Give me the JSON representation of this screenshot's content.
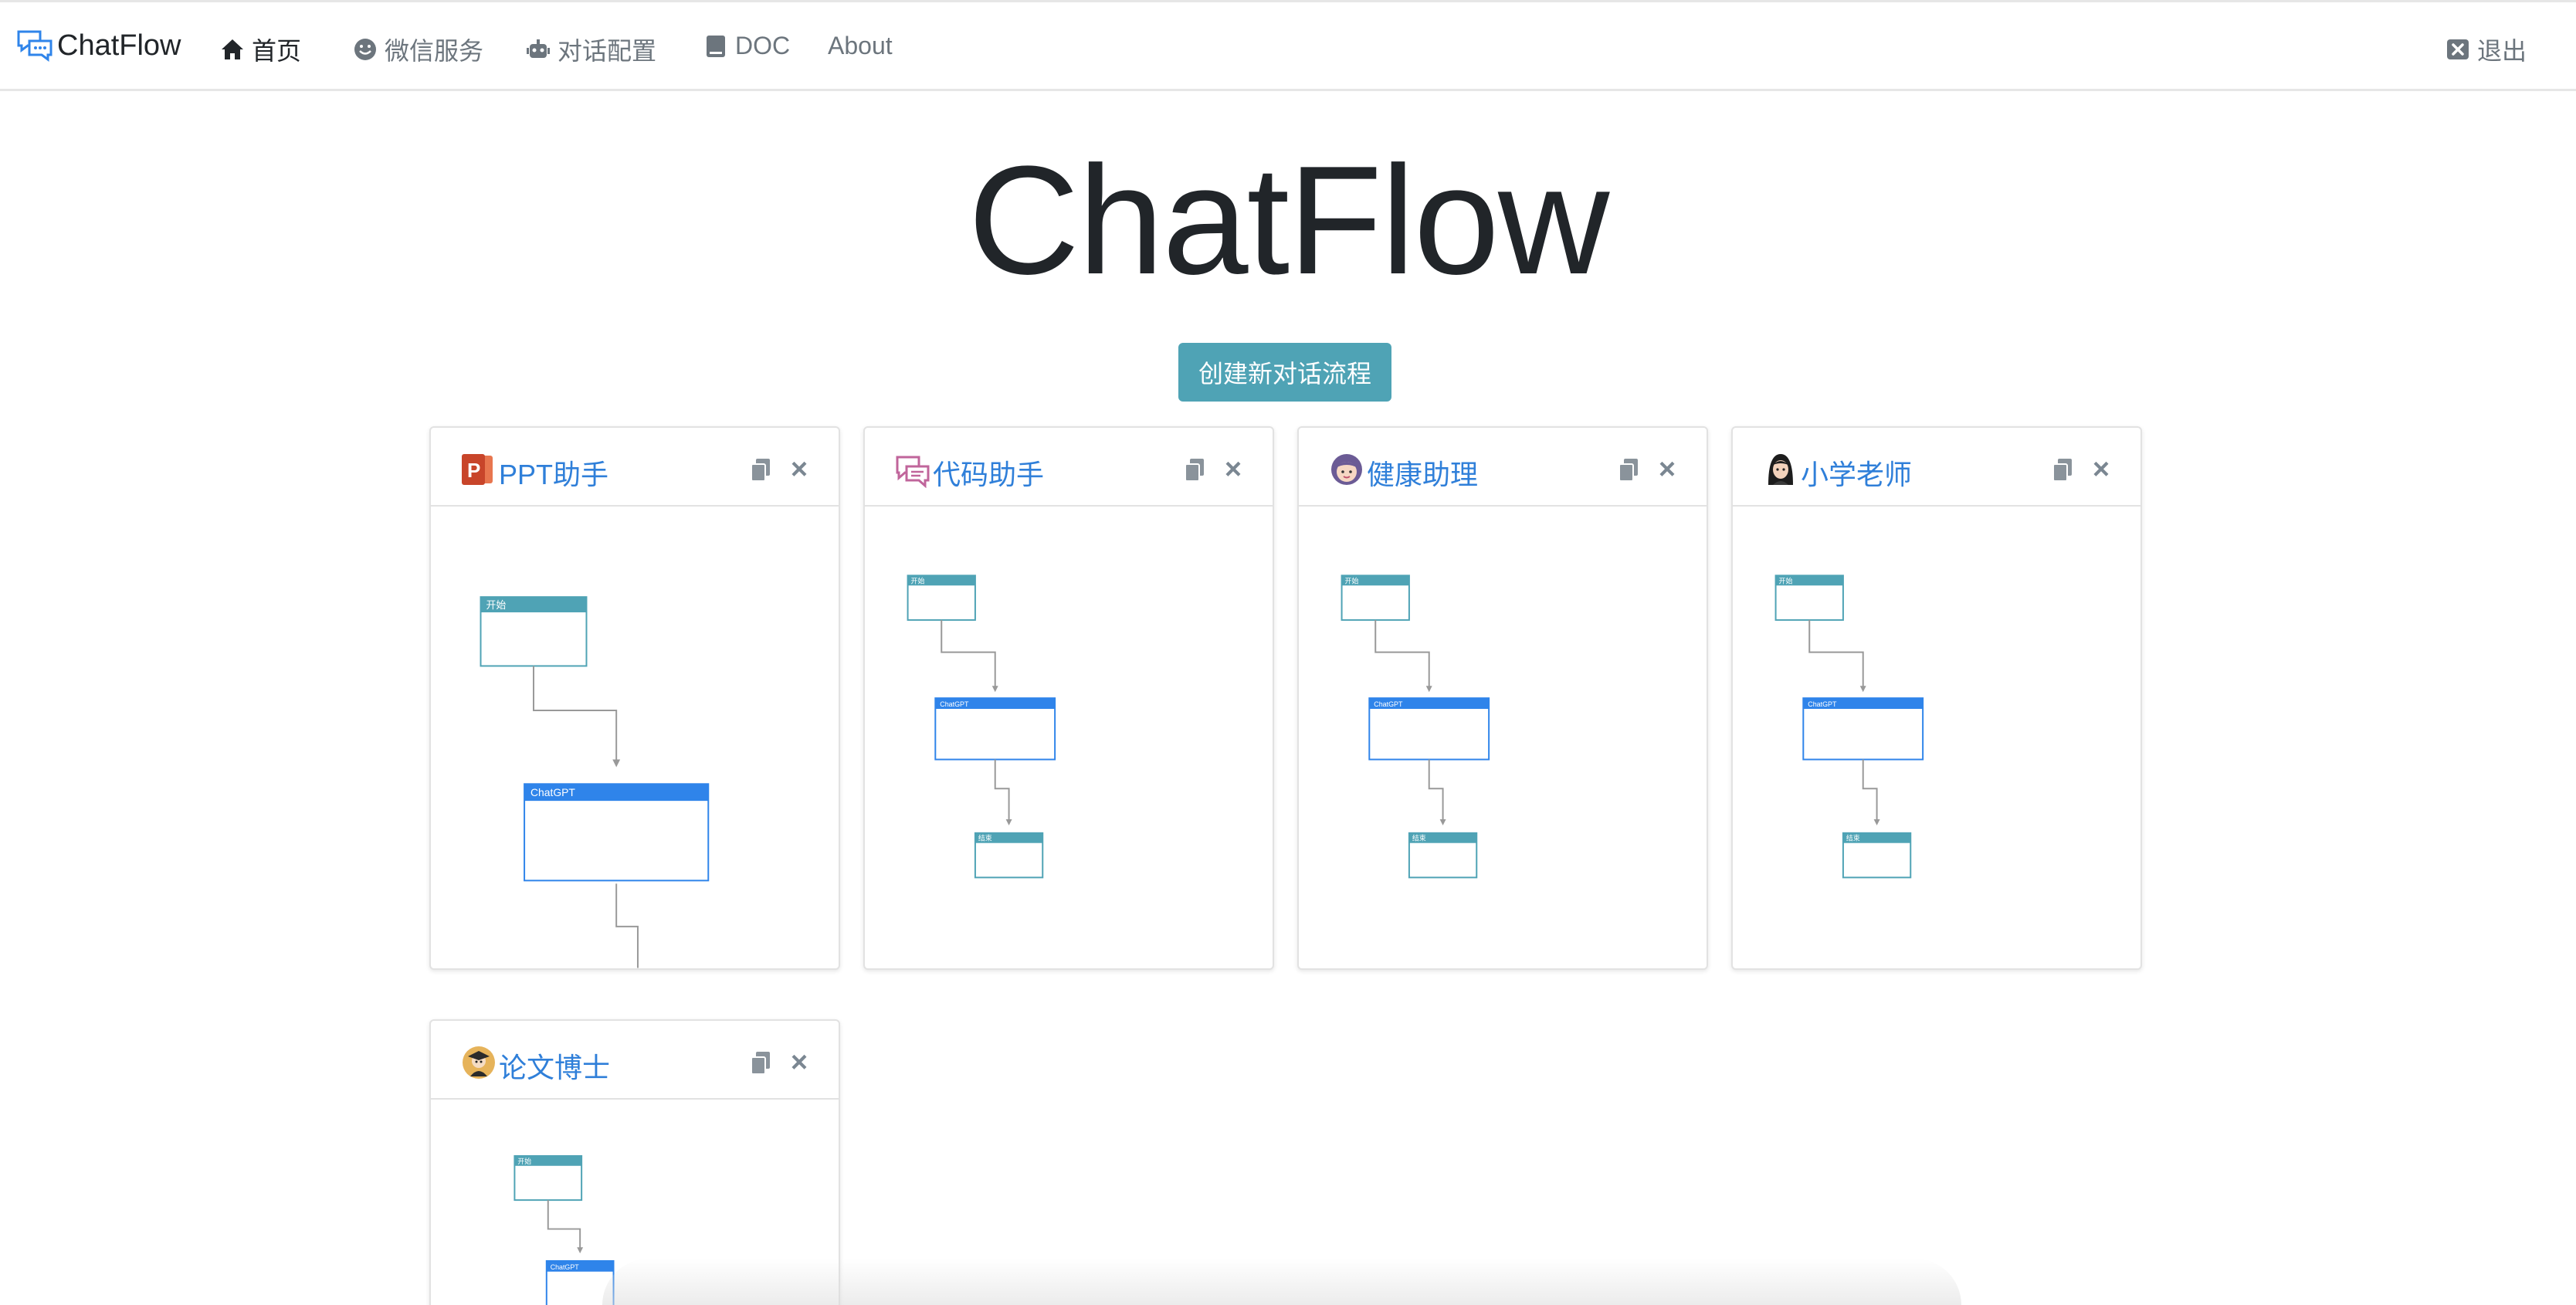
{
  "navbar": {
    "brand": "ChatFlow",
    "items": [
      {
        "label": "首页",
        "icon": "home-icon"
      },
      {
        "label": "微信服务",
        "icon": "smile-icon"
      },
      {
        "label": "对话配置",
        "icon": "robot-icon"
      },
      {
        "label": "DOC",
        "icon": "book-icon"
      },
      {
        "label": "About"
      }
    ],
    "logout": {
      "label": "退出",
      "icon": "close-square-icon"
    }
  },
  "hero": {
    "title": "ChatFlow"
  },
  "actions": {
    "create_label": "创建新对话流程"
  },
  "flows": [
    {
      "title": "PPT助手",
      "icon": "ppt-icon",
      "nodes": [
        "开始",
        "ChatGPT"
      ]
    },
    {
      "title": "代码助手",
      "icon": "chat-bubbles-icon",
      "nodes": [
        "开始",
        "ChatGPT",
        "结束"
      ]
    },
    {
      "title": "健康助理",
      "icon": "girl-avatar-icon",
      "nodes": [
        "开始",
        "ChatGPT",
        "结束"
      ]
    },
    {
      "title": "小学老师",
      "icon": "teacher-avatar-icon",
      "nodes": [
        "开始",
        "ChatGPT",
        "结束"
      ]
    },
    {
      "title": "论文博士",
      "icon": "doctor-avatar-icon",
      "nodes": [
        "开始",
        "ChatGPT"
      ]
    }
  ],
  "colors": {
    "accent": "#4fa3b5",
    "link": "#2f7fd9",
    "node_start": "#4fa3b5",
    "node_gpt": "#2f84ea"
  }
}
